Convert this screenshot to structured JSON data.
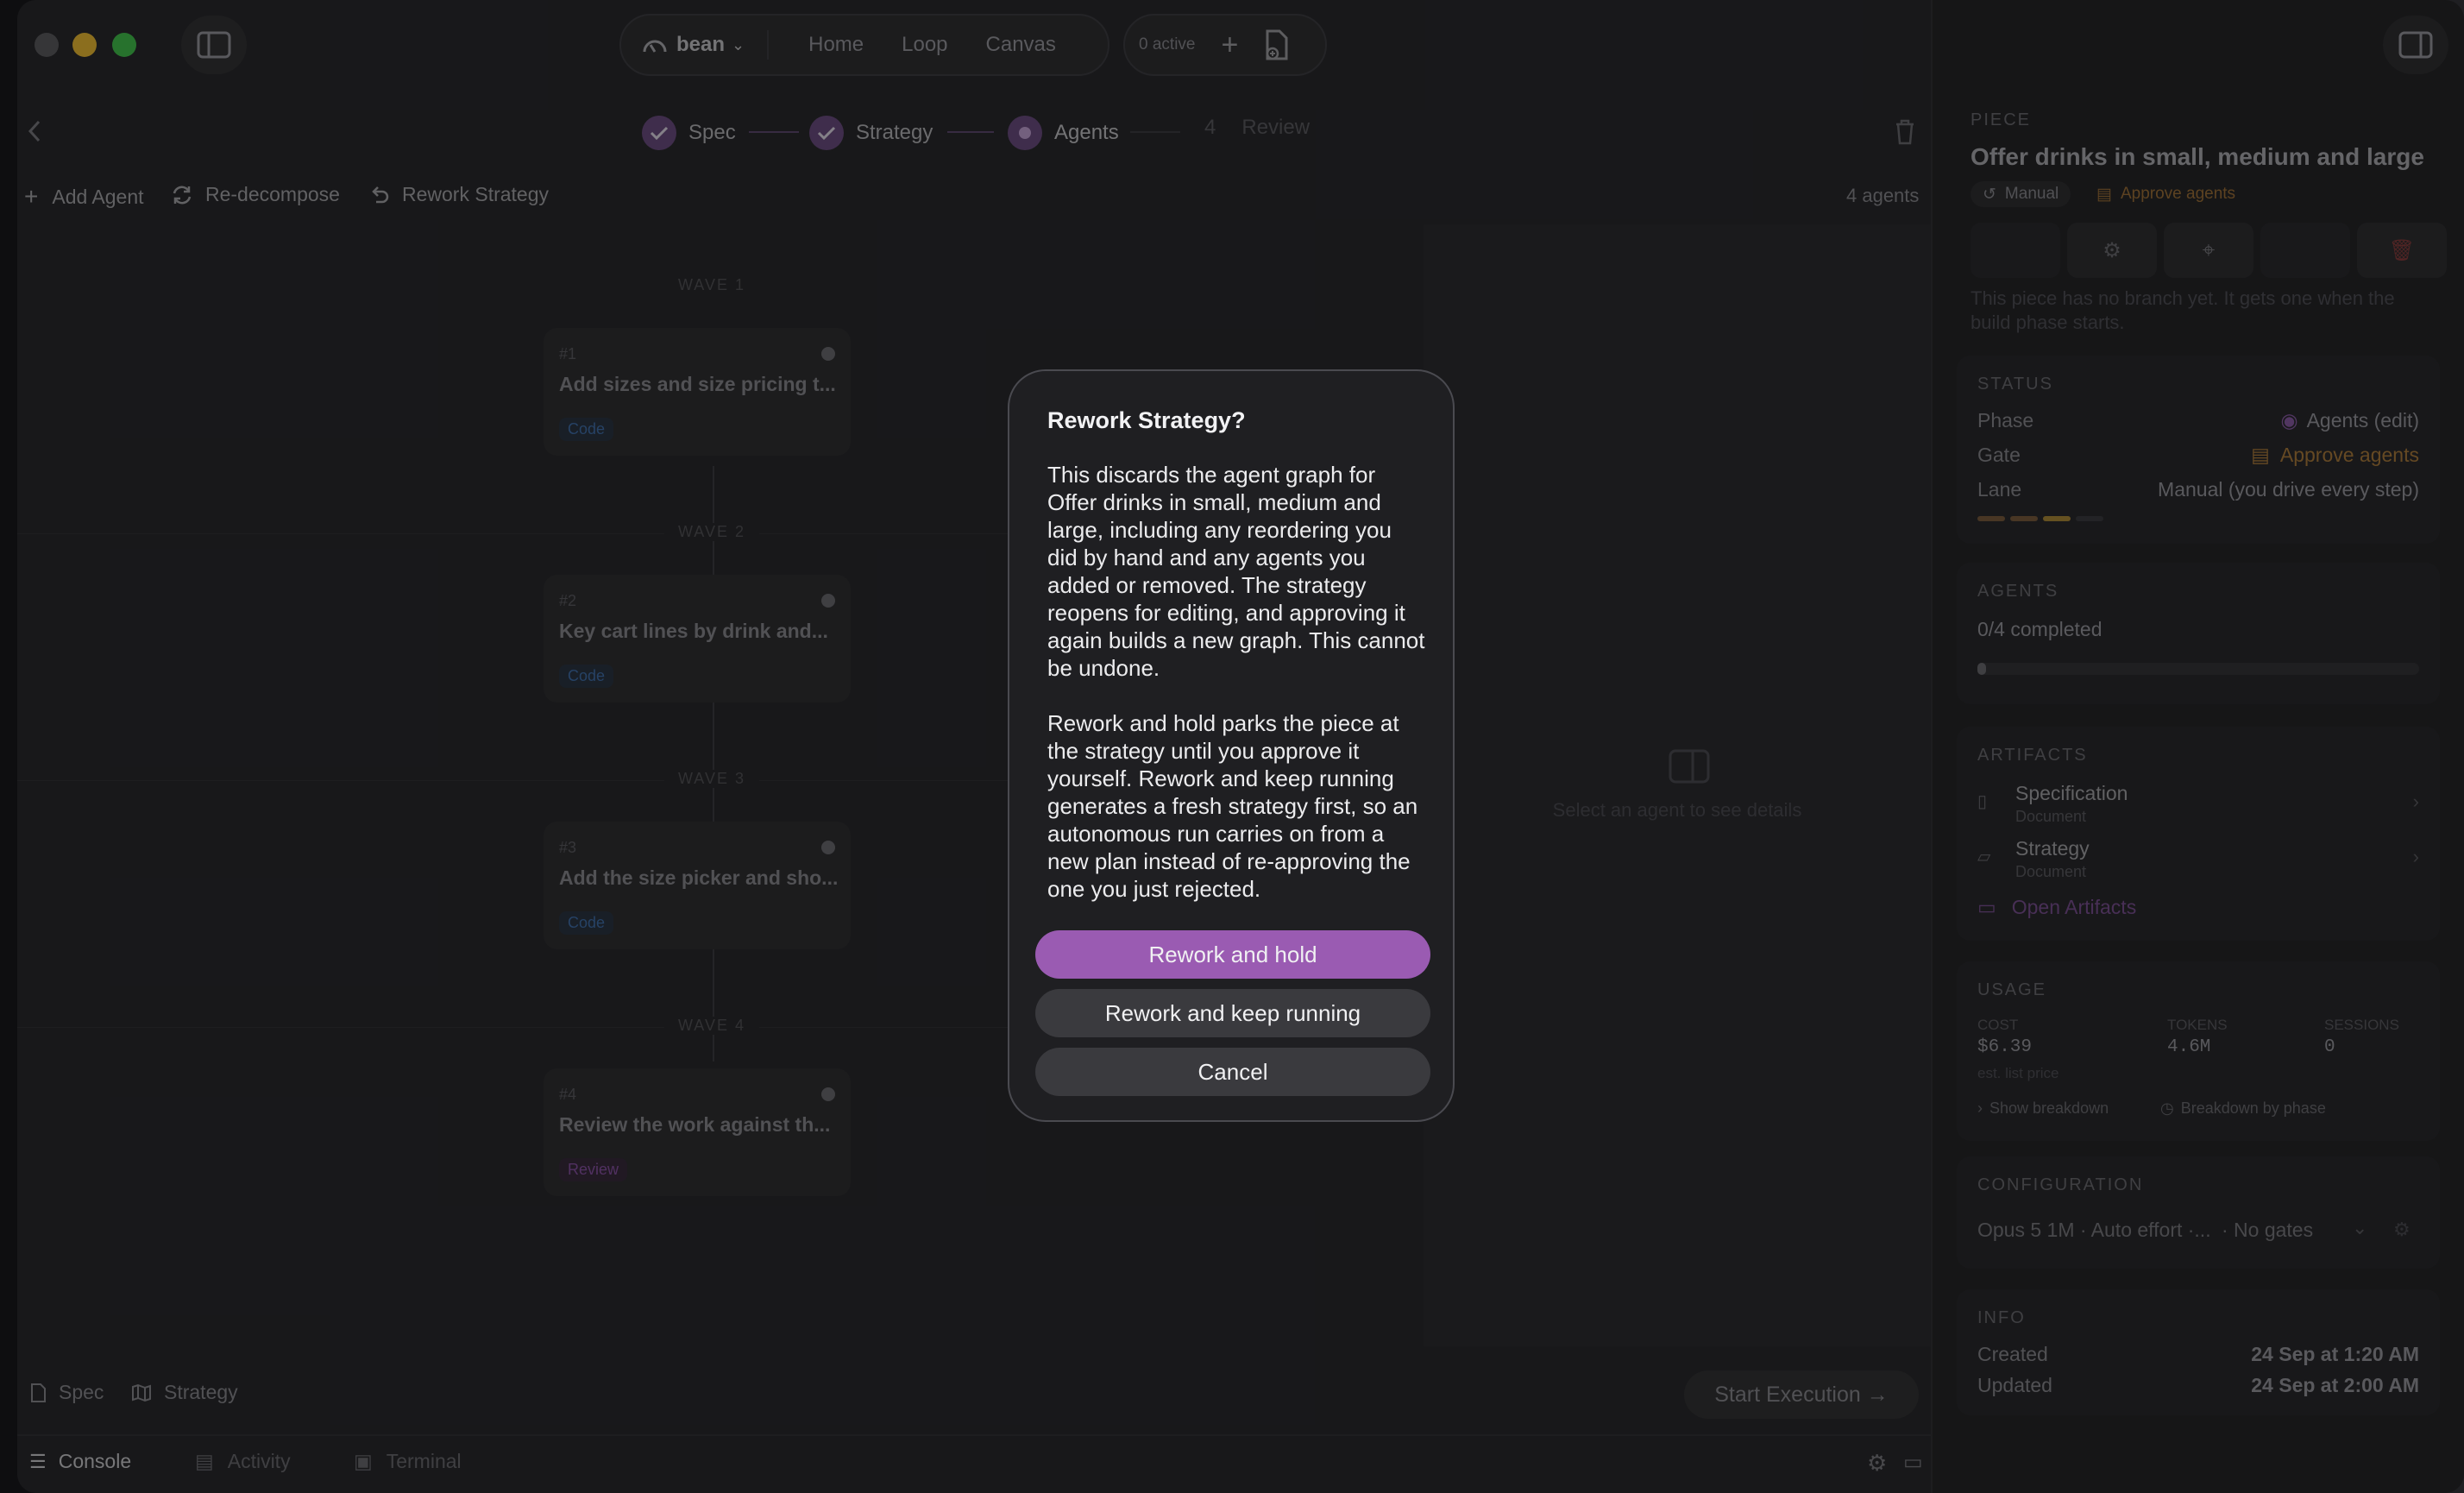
{
  "titlebar": {
    "workspace": "bean",
    "nav": [
      "Home",
      "Loop",
      "Canvas"
    ],
    "active_count": "0 active"
  },
  "stepper": {
    "steps": [
      {
        "label": "Spec",
        "state": "done"
      },
      {
        "label": "Strategy",
        "state": "done"
      },
      {
        "label": "Agents",
        "state": "current"
      },
      {
        "label": "Review",
        "state": "pending",
        "number": "4"
      }
    ]
  },
  "actions": {
    "add_agent": "Add Agent",
    "redecompose": "Re-decompose",
    "rework_strategy": "Rework Strategy",
    "agent_count": "4 agents"
  },
  "waves": [
    {
      "label": "WAVE 1",
      "card": {
        "num": "#1",
        "title": "Add sizes and size pricing t...",
        "tag": "Code"
      }
    },
    {
      "label": "WAVE 2",
      "card": {
        "num": "#2",
        "title": "Key cart lines by drink and...",
        "tag": "Code"
      }
    },
    {
      "label": "WAVE 3",
      "card": {
        "num": "#3",
        "title": "Add the size picker and sho...",
        "tag": "Code"
      }
    },
    {
      "label": "WAVE 4",
      "card": {
        "num": "#4",
        "title": "Review the work against th...",
        "tag": "Review"
      }
    }
  ],
  "detail_placeholder": "Select an agent to see details",
  "footer": {
    "spec": "Spec",
    "strategy": "Strategy",
    "start": "Start Execution →",
    "console": "Console",
    "activity": "Activity",
    "terminal": "Terminal"
  },
  "panel": {
    "eyebrow": "PIECE",
    "title": "Offer drinks in small, medium and large",
    "lane_badge": "Manual",
    "gate_badge": "Approve agents",
    "branch_note": "This piece has no branch yet. It gets one when the build phase starts.",
    "status": {
      "title": "STATUS",
      "phase_k": "Phase",
      "phase_v": "Agents (edit)",
      "gate_k": "Gate",
      "gate_v": "Approve agents",
      "lane_k": "Lane",
      "lane_v": "Manual (you drive every step)"
    },
    "agents": {
      "title": "AGENTS",
      "completed": "0/4 completed",
      "progress": 0
    },
    "artifacts": {
      "title": "ARTIFACTS",
      "items": [
        {
          "name": "Specification",
          "type": "Document"
        },
        {
          "name": "Strategy",
          "type": "Document"
        }
      ],
      "open": "Open Artifacts"
    },
    "usage": {
      "title": "USAGE",
      "cost_k": "COST",
      "cost_v": "$6.39",
      "cost_note": "est. list price",
      "tokens_k": "TOKENS",
      "tokens_v": "4.6M",
      "sessions_k": "SESSIONS",
      "sessions_v": "0",
      "show_breakdown": "Show breakdown",
      "by_phase": "Breakdown by phase"
    },
    "configuration": {
      "title": "CONFIGURATION",
      "model": "Opus 5 1M · Auto effort ·...",
      "gates": "· No gates"
    },
    "info": {
      "title": "INFO",
      "created_k": "Created",
      "created_v": "24 Sep at 1:20 AM",
      "updated_k": "Updated",
      "updated_v": "24 Sep at 2:00 AM"
    }
  },
  "dialog": {
    "title": "Rework Strategy?",
    "para1": "This discards the agent graph for Offer drinks in small, medium and large, including any reordering you did by hand and any agents you added or removed. The strategy reopens for editing, and approving it again builds a new graph. This cannot be undone.",
    "para2": "Rework and hold parks the piece at the strategy until you approve it yourself. Rework and keep running generates a fresh strategy first, so an autonomous run carries on from a new plan instead of re-approving the one you just rejected.",
    "btn_hold": "Rework and hold",
    "btn_keep": "Rework and keep running",
    "btn_cancel": "Cancel"
  },
  "colors": {
    "accent": "#9a5bb2",
    "gate": "#c98a3a",
    "code_tag": "#3c6fb0",
    "review_tag": "#8a4fa8"
  }
}
